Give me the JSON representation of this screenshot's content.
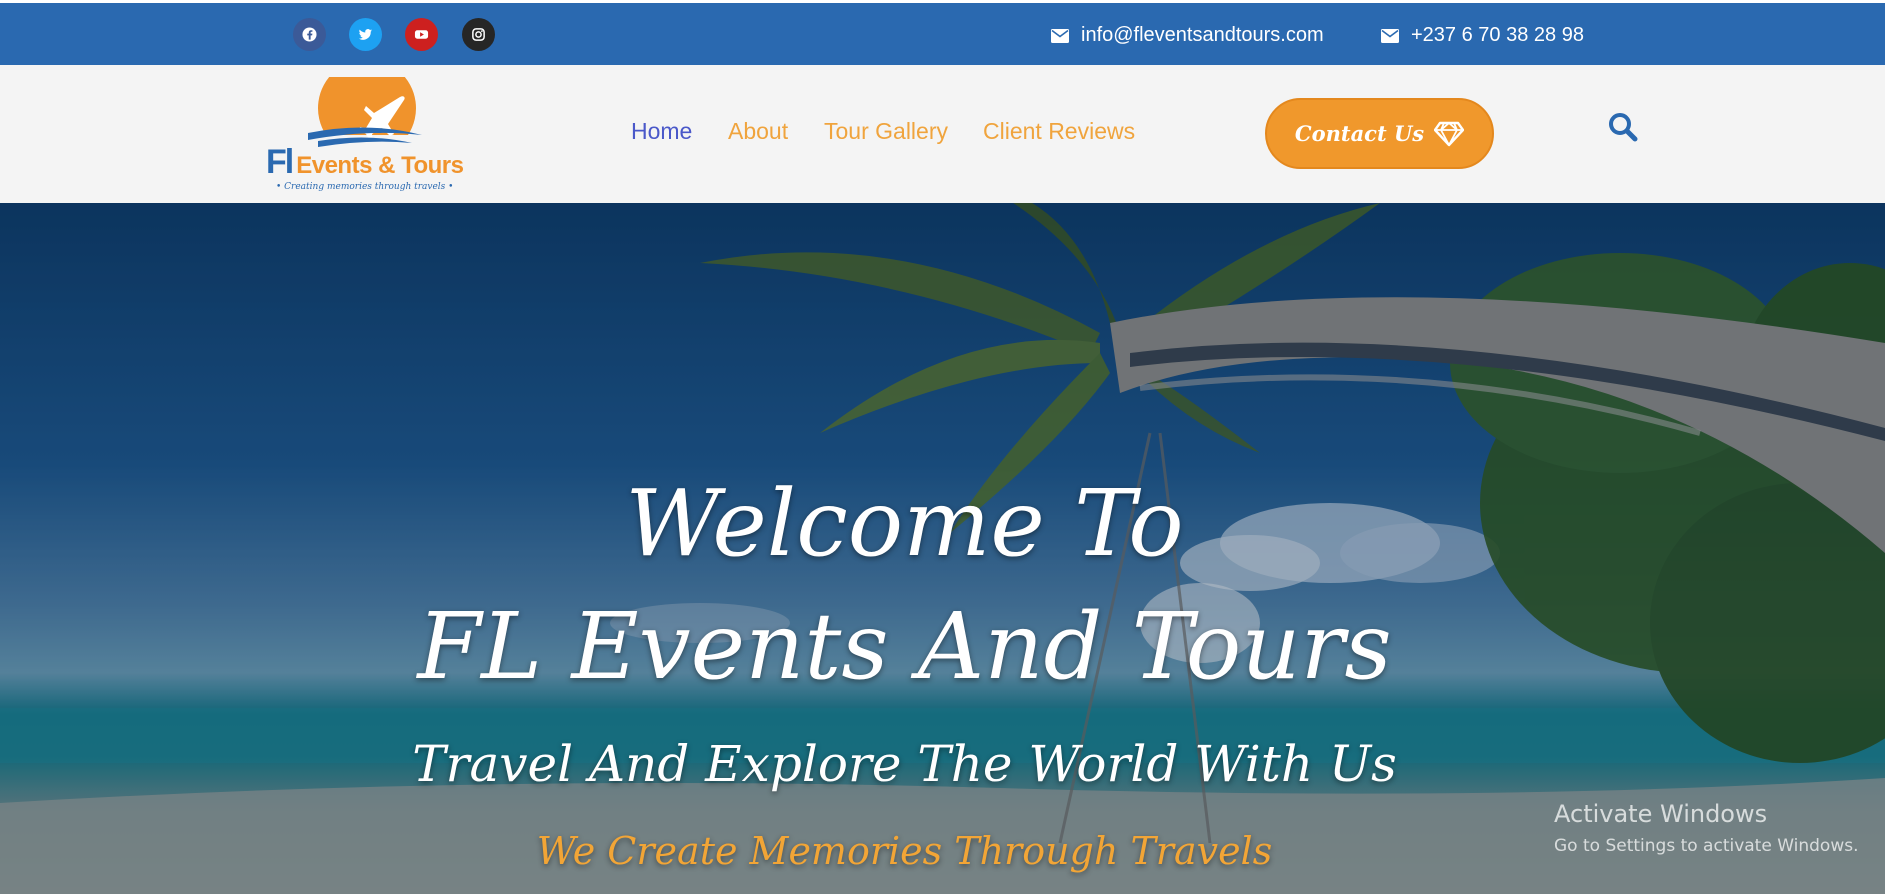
{
  "topbar": {
    "social": [
      {
        "icon": "facebook-icon",
        "color": "#3b5a98"
      },
      {
        "icon": "twitter-icon",
        "color": "#1da1f2"
      },
      {
        "icon": "youtube-icon",
        "color": "#cd201f"
      },
      {
        "icon": "instagram-icon",
        "color": "#262626"
      }
    ],
    "email": "info@fleventsandtours.com",
    "phone": "+237 6 70 38 28 98"
  },
  "header": {
    "logo": {
      "mark": "Fl",
      "name": "Events & Tours",
      "tagline": "• Creating memories through travels •"
    },
    "nav": [
      "Home",
      "About",
      "Tour Gallery",
      "Client Reviews"
    ],
    "active_nav": "Home",
    "contact_button": "Contact Us",
    "colors": {
      "accent": "#f0982c",
      "brand_blue": "#2a69b0",
      "nav_active": "#4a58c9"
    }
  },
  "hero": {
    "line1": "Welcome To",
    "line2": "FL Events And Tours",
    "line3": "Travel And Explore The World With Us",
    "line4": "We Create Memories Through Travels"
  },
  "watermark": {
    "title": "Activate Windows",
    "subtitle": "Go to Settings to activate Windows."
  }
}
